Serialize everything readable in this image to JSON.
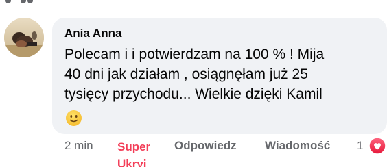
{
  "comment": {
    "author": "Ania Anna",
    "text_lines": [
      "Polecam i i potwierdzam na 100 % ! Mija",
      "40 dni jak działam , osiągnęłam już 25",
      "tysięcy przychodu... Wielkie dzięki Kamil"
    ],
    "emoji": "slightly-smiling-face-icon"
  },
  "actions": {
    "time": "2 min",
    "reaction_label": "Super Ukryj",
    "reply_label": "Odpowiedz",
    "message_label": "Wiadomość",
    "reaction_count": "1"
  },
  "colors": {
    "bubble": "#f0f2f5",
    "text": "#050505",
    "secondary": "#65676b",
    "love": "#f33e58"
  }
}
